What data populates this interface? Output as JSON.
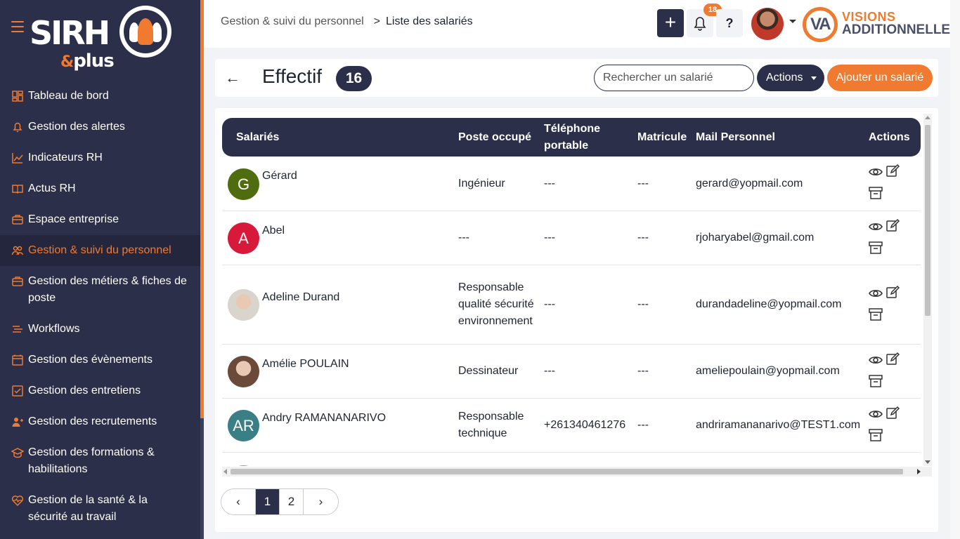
{
  "app": {
    "logo_text": "SIRH",
    "logo_sub_amp": "&",
    "logo_sub": "plus",
    "brand_line1": "VISIONS",
    "brand_line2": "ADDITIONNELLES",
    "brand_mark": "VA"
  },
  "sidebar": {
    "items": [
      {
        "label": "Tableau de bord",
        "icon": "dashboard-icon"
      },
      {
        "label": "Gestion des alertes",
        "icon": "bell-icon"
      },
      {
        "label": "Indicateurs RH",
        "icon": "chart-line-icon"
      },
      {
        "label": "Actus RH",
        "icon": "book-icon"
      },
      {
        "label": "Espace entreprise",
        "icon": "briefcase-icon"
      },
      {
        "label": "Gestion & suivi du personnel",
        "icon": "users-icon",
        "active": true
      },
      {
        "label": "Gestion des métiers & fiches de poste",
        "icon": "briefcase-icon"
      },
      {
        "label": "Workflows",
        "icon": "list-icon"
      },
      {
        "label": "Gestion des évènements",
        "icon": "calendar-icon"
      },
      {
        "label": "Gestion des entretiens",
        "icon": "checklist-icon"
      },
      {
        "label": "Gestion des recrutements",
        "icon": "user-plus-icon"
      },
      {
        "label": "Gestion des formations & habilitations",
        "icon": "graduation-icon"
      },
      {
        "label": "Gestion de la santé & la sécurité au travail",
        "icon": "heart-pulse-icon"
      }
    ]
  },
  "header": {
    "breadcrumb_parent": "Gestion & suivi du personnel",
    "breadcrumb_sep": ">",
    "breadcrumb_current": "Liste des salariés",
    "plus_label": "+",
    "help_label": "?",
    "notification_count": "18"
  },
  "effectif": {
    "title": "Effectif",
    "count": "16",
    "search_placeholder": "Rechercher un salarié",
    "actions_label": "Actions",
    "add_label": "Ajouter un salarié"
  },
  "table": {
    "columns": [
      "Salariés",
      "Poste occupé",
      "Téléphone portable",
      "Matricule",
      "Mail Personnel",
      "Actions"
    ],
    "rows": [
      {
        "initials": "G",
        "avatar_color": "#4f6d0f",
        "photo": false,
        "name": "Gérard",
        "poste": "Ingénieur",
        "tel": "---",
        "matricule": "---",
        "mail": "gerard@yopmail.com"
      },
      {
        "initials": "A",
        "avatar_color": "#d7193a",
        "photo": false,
        "name": "Abel",
        "poste": "---",
        "tel": "---",
        "matricule": "---",
        "mail": "rjoharyabel@gmail.com"
      },
      {
        "initials": "",
        "avatar_color": "#d9d4cc",
        "photo": true,
        "name": "Adeline Durand",
        "poste": "Responsable qualité sécurité environnement",
        "tel": "---",
        "matricule": "---",
        "mail": "durandadeline@yopmail.com"
      },
      {
        "initials": "",
        "avatar_color": "#6b4a3a",
        "photo": true,
        "name": "Amélie POULAIN",
        "poste": "Dessinateur",
        "tel": "---",
        "matricule": "---",
        "mail": "ameliepoulain@yopmail.com"
      },
      {
        "initials": "AR",
        "avatar_color": "#3a7f86",
        "photo": false,
        "name": "Andry RAMANANARIVO",
        "poste": "Responsable technique",
        "tel": "+261340461276",
        "matricule": "---",
        "mail": "andriramananarivo@TEST1.com"
      },
      {
        "initials": "",
        "avatar_color": "#4cbf73",
        "photo": false,
        "name": "",
        "poste": "",
        "tel": "",
        "matricule": "",
        "mail": ""
      }
    ]
  },
  "pagination": {
    "prev": "‹",
    "pages": [
      "1",
      "2"
    ],
    "current": "1",
    "next": "›"
  },
  "colors": {
    "sidebar_bg": "#2b2f4a",
    "accent": "#f07a2f",
    "table_header_bg": "#2b2f4a"
  }
}
